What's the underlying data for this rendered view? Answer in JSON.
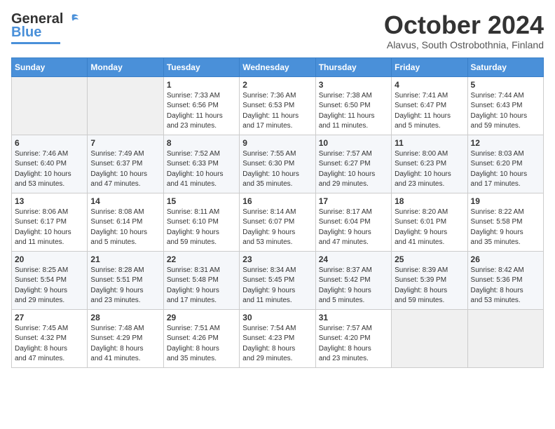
{
  "header": {
    "logo_general": "General",
    "logo_blue": "Blue",
    "month_title": "October 2024",
    "subtitle": "Alavus, South Ostrobothnia, Finland"
  },
  "days_of_week": [
    "Sunday",
    "Monday",
    "Tuesday",
    "Wednesday",
    "Thursday",
    "Friday",
    "Saturday"
  ],
  "weeks": [
    [
      {
        "day": "",
        "info": ""
      },
      {
        "day": "",
        "info": ""
      },
      {
        "day": "1",
        "info": "Sunrise: 7:33 AM\nSunset: 6:56 PM\nDaylight: 11 hours\nand 23 minutes."
      },
      {
        "day": "2",
        "info": "Sunrise: 7:36 AM\nSunset: 6:53 PM\nDaylight: 11 hours\nand 17 minutes."
      },
      {
        "day": "3",
        "info": "Sunrise: 7:38 AM\nSunset: 6:50 PM\nDaylight: 11 hours\nand 11 minutes."
      },
      {
        "day": "4",
        "info": "Sunrise: 7:41 AM\nSunset: 6:47 PM\nDaylight: 11 hours\nand 5 minutes."
      },
      {
        "day": "5",
        "info": "Sunrise: 7:44 AM\nSunset: 6:43 PM\nDaylight: 10 hours\nand 59 minutes."
      }
    ],
    [
      {
        "day": "6",
        "info": "Sunrise: 7:46 AM\nSunset: 6:40 PM\nDaylight: 10 hours\nand 53 minutes."
      },
      {
        "day": "7",
        "info": "Sunrise: 7:49 AM\nSunset: 6:37 PM\nDaylight: 10 hours\nand 47 minutes."
      },
      {
        "day": "8",
        "info": "Sunrise: 7:52 AM\nSunset: 6:33 PM\nDaylight: 10 hours\nand 41 minutes."
      },
      {
        "day": "9",
        "info": "Sunrise: 7:55 AM\nSunset: 6:30 PM\nDaylight: 10 hours\nand 35 minutes."
      },
      {
        "day": "10",
        "info": "Sunrise: 7:57 AM\nSunset: 6:27 PM\nDaylight: 10 hours\nand 29 minutes."
      },
      {
        "day": "11",
        "info": "Sunrise: 8:00 AM\nSunset: 6:23 PM\nDaylight: 10 hours\nand 23 minutes."
      },
      {
        "day": "12",
        "info": "Sunrise: 8:03 AM\nSunset: 6:20 PM\nDaylight: 10 hours\nand 17 minutes."
      }
    ],
    [
      {
        "day": "13",
        "info": "Sunrise: 8:06 AM\nSunset: 6:17 PM\nDaylight: 10 hours\nand 11 minutes."
      },
      {
        "day": "14",
        "info": "Sunrise: 8:08 AM\nSunset: 6:14 PM\nDaylight: 10 hours\nand 5 minutes."
      },
      {
        "day": "15",
        "info": "Sunrise: 8:11 AM\nSunset: 6:10 PM\nDaylight: 9 hours\nand 59 minutes."
      },
      {
        "day": "16",
        "info": "Sunrise: 8:14 AM\nSunset: 6:07 PM\nDaylight: 9 hours\nand 53 minutes."
      },
      {
        "day": "17",
        "info": "Sunrise: 8:17 AM\nSunset: 6:04 PM\nDaylight: 9 hours\nand 47 minutes."
      },
      {
        "day": "18",
        "info": "Sunrise: 8:20 AM\nSunset: 6:01 PM\nDaylight: 9 hours\nand 41 minutes."
      },
      {
        "day": "19",
        "info": "Sunrise: 8:22 AM\nSunset: 5:58 PM\nDaylight: 9 hours\nand 35 minutes."
      }
    ],
    [
      {
        "day": "20",
        "info": "Sunrise: 8:25 AM\nSunset: 5:54 PM\nDaylight: 9 hours\nand 29 minutes."
      },
      {
        "day": "21",
        "info": "Sunrise: 8:28 AM\nSunset: 5:51 PM\nDaylight: 9 hours\nand 23 minutes."
      },
      {
        "day": "22",
        "info": "Sunrise: 8:31 AM\nSunset: 5:48 PM\nDaylight: 9 hours\nand 17 minutes."
      },
      {
        "day": "23",
        "info": "Sunrise: 8:34 AM\nSunset: 5:45 PM\nDaylight: 9 hours\nand 11 minutes."
      },
      {
        "day": "24",
        "info": "Sunrise: 8:37 AM\nSunset: 5:42 PM\nDaylight: 9 hours\nand 5 minutes."
      },
      {
        "day": "25",
        "info": "Sunrise: 8:39 AM\nSunset: 5:39 PM\nDaylight: 8 hours\nand 59 minutes."
      },
      {
        "day": "26",
        "info": "Sunrise: 8:42 AM\nSunset: 5:36 PM\nDaylight: 8 hours\nand 53 minutes."
      }
    ],
    [
      {
        "day": "27",
        "info": "Sunrise: 7:45 AM\nSunset: 4:32 PM\nDaylight: 8 hours\nand 47 minutes."
      },
      {
        "day": "28",
        "info": "Sunrise: 7:48 AM\nSunset: 4:29 PM\nDaylight: 8 hours\nand 41 minutes."
      },
      {
        "day": "29",
        "info": "Sunrise: 7:51 AM\nSunset: 4:26 PM\nDaylight: 8 hours\nand 35 minutes."
      },
      {
        "day": "30",
        "info": "Sunrise: 7:54 AM\nSunset: 4:23 PM\nDaylight: 8 hours\nand 29 minutes."
      },
      {
        "day": "31",
        "info": "Sunrise: 7:57 AM\nSunset: 4:20 PM\nDaylight: 8 hours\nand 23 minutes."
      },
      {
        "day": "",
        "info": ""
      },
      {
        "day": "",
        "info": ""
      }
    ]
  ]
}
